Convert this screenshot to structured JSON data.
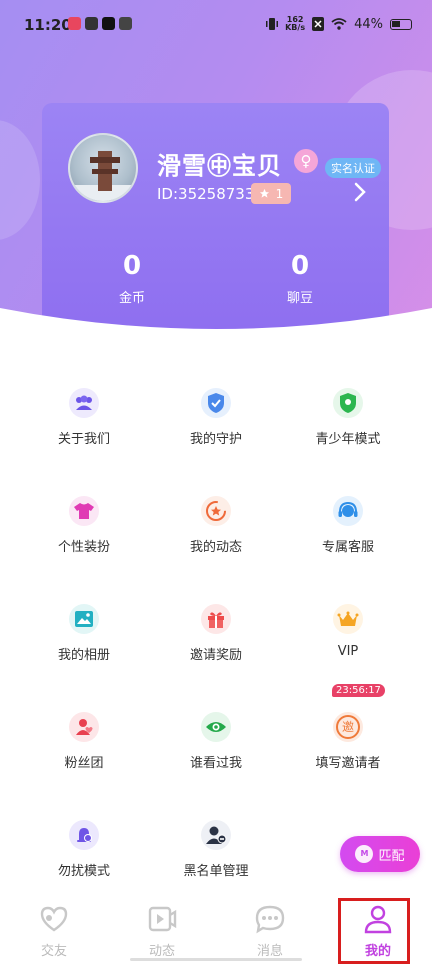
{
  "status_bar": {
    "time": "11:20",
    "net_speed_value": "162",
    "net_speed_unit": "KB/s",
    "battery": "44%"
  },
  "profile": {
    "username": "滑雪㊥宝贝",
    "gender_symbol": "♀",
    "verify_label": "实名认证",
    "user_id": "ID:35258733",
    "level": "1",
    "coins_value": "0",
    "coins_label": "金币",
    "beans_value": "0",
    "beans_label": "聊豆"
  },
  "menu": {
    "about": "关于我们",
    "guard": "我的守护",
    "teen_mode": "青少年模式",
    "dressup": "个性装扮",
    "moments": "我的动态",
    "service": "专属客服",
    "album": "我的相册",
    "invite_reward": "邀请奖励",
    "vip": "VIP",
    "fans": "粉丝团",
    "visitors": "谁看过我",
    "fill_inviter": "填写邀请者",
    "fill_inviter_icon_char": "邀",
    "dnd": "勿扰模式",
    "blacklist": "黑名单管理"
  },
  "timer": "23:56:17",
  "match_button": {
    "label": "匹配",
    "icon_text": "M"
  },
  "tabs": [
    "交友",
    "动态",
    "消息",
    "我的"
  ],
  "colors": {
    "accent": "#c142e0",
    "card": "#9179f2",
    "timer": "#e84167"
  }
}
